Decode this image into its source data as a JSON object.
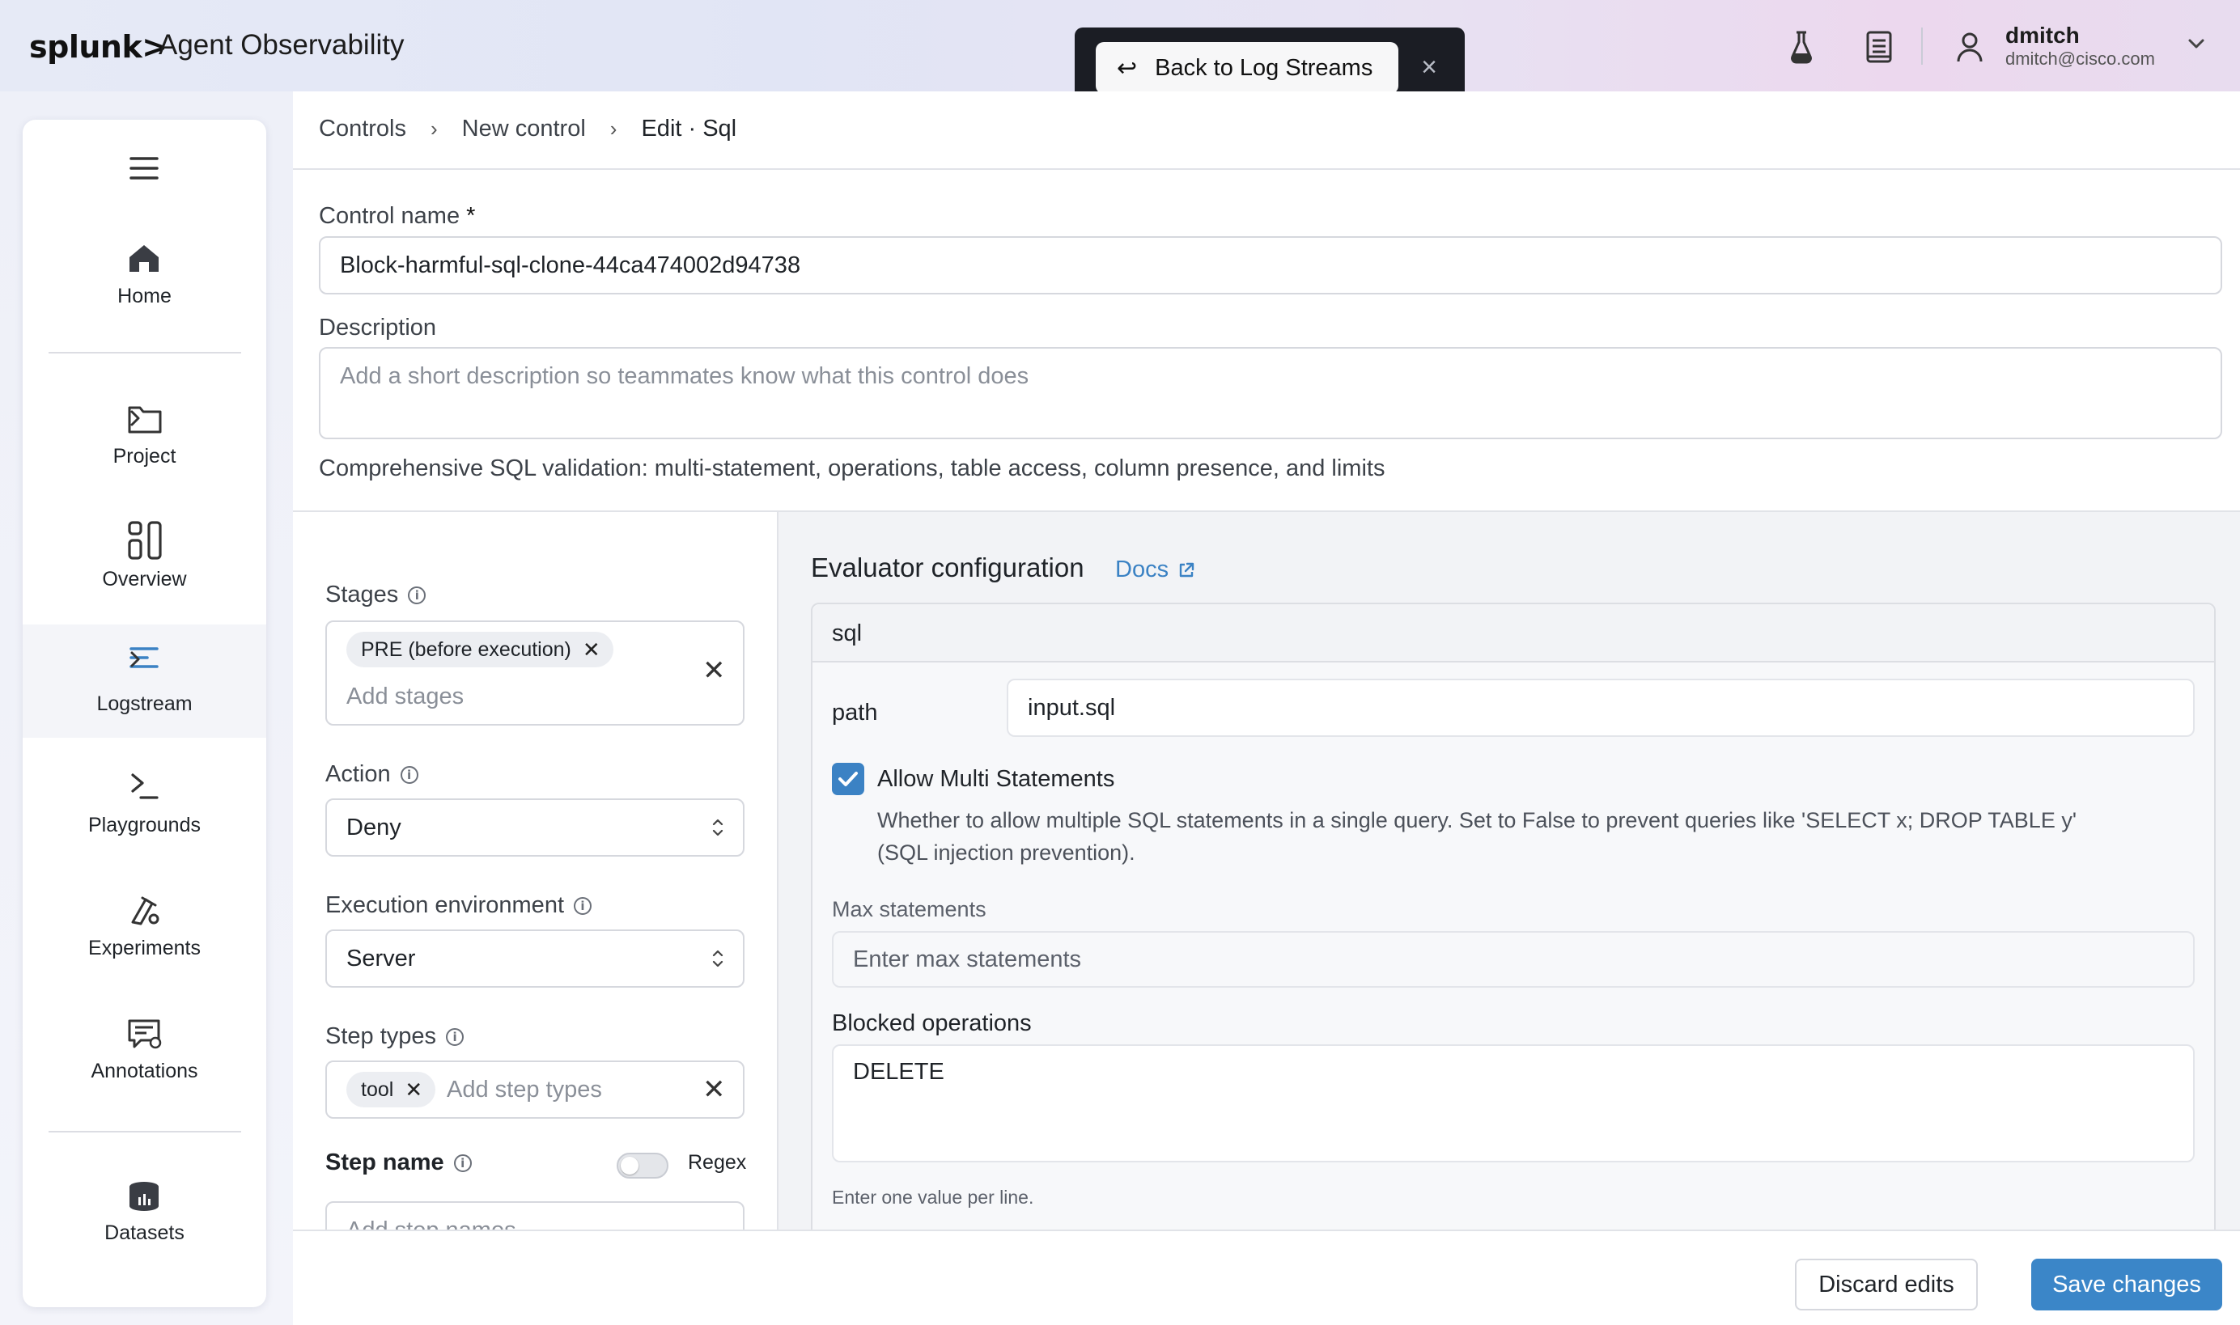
{
  "header": {
    "logo": "splunk>",
    "app_title": "Agent Observability",
    "back_button": "Back to Log Streams",
    "toast_close": "×",
    "user": {
      "name": "dmitch",
      "email": "dmitch@cisco.com"
    },
    "icons": [
      "flask-icon",
      "book-icon",
      "user-icon",
      "chevron-down-icon"
    ]
  },
  "sidebar": {
    "items": [
      {
        "label": "Home",
        "icon": "home-icon"
      },
      {
        "label": "Project",
        "icon": "folder-icon",
        "has_submenu": true
      },
      {
        "label": "Overview",
        "icon": "overview-icon"
      },
      {
        "label": "Logstream",
        "icon": "logstream-icon",
        "has_submenu": true,
        "active": true
      },
      {
        "label": "Playgrounds",
        "icon": "terminal-icon"
      },
      {
        "label": "Experiments",
        "icon": "experiments-icon"
      },
      {
        "label": "Annotations",
        "icon": "annotations-icon"
      },
      {
        "label": "Datasets",
        "icon": "database-icon"
      }
    ],
    "accent_color": "#3b82c4"
  },
  "breadcrumb": {
    "items": [
      "Controls",
      "New control",
      "Edit · Sql"
    ],
    "separator": "›"
  },
  "form": {
    "control_name_label": "Control name",
    "required_mark": "*",
    "control_name_value": "Block-harmful-sql-clone-44ca474002d94738",
    "description_label": "Description",
    "description_placeholder": "Add a short description so teammates know what this control does",
    "description_help": "Comprehensive SQL validation: multi-statement, operations, table access, column presence, and limits"
  },
  "config": {
    "stages_label": "Stages",
    "stages_chips": [
      "PRE (before execution)"
    ],
    "stages_placeholder": "Add stages",
    "action_label": "Action",
    "action_value": "Deny",
    "exec_env_label": "Execution environment",
    "exec_env_value": "Server",
    "step_types_label": "Step types",
    "step_types_chips": [
      "tool"
    ],
    "step_types_placeholder": "Add step types",
    "step_name_label": "Step name",
    "regex_label": "Regex",
    "regex_enabled": false,
    "step_names_placeholder": "Add step names"
  },
  "evaluator": {
    "title": "Evaluator configuration",
    "docs_label": "Docs",
    "card_title": "sql",
    "path_label": "path",
    "path_value": "input.sql",
    "allow_multi_label": "Allow Multi Statements",
    "allow_multi_checked": true,
    "allow_multi_help_1": "Whether to allow multiple SQL statements in a single query. Set to False to prevent queries like 'SELECT x; DROP TABLE y'",
    "allow_multi_help_2": "(SQL injection prevention).",
    "max_statements_label": "Max statements",
    "max_statements_placeholder": "Enter max statements",
    "blocked_ops_label": "Blocked operations",
    "blocked_ops_value": "DELETE",
    "blocked_ops_help": "Enter one value per line."
  },
  "footer": {
    "discard_label": "Discard edits",
    "save_label": "Save changes",
    "save_color": "#3b86c8"
  }
}
